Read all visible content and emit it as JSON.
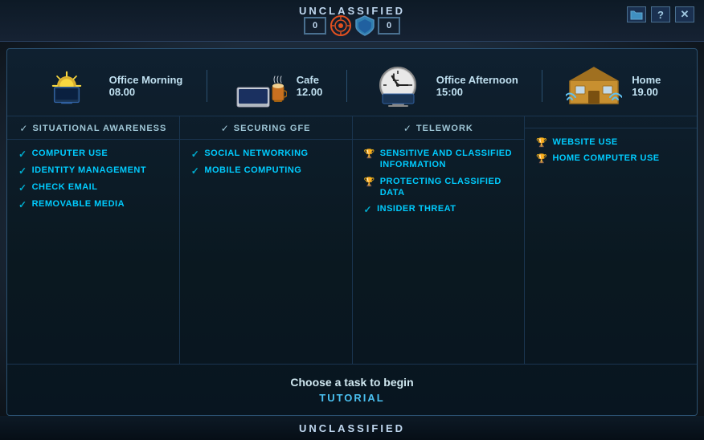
{
  "classification": {
    "top_label": "UNCLASSIFIED",
    "bottom_label": "UNCLASSIFIED"
  },
  "top_bar": {
    "score_left": "0",
    "score_right": "0",
    "buttons": [
      "folder-icon",
      "question-icon",
      "close-icon"
    ]
  },
  "timeline": {
    "items": [
      {
        "name": "Office Morning",
        "time": "08.00",
        "icon": "sun"
      },
      {
        "name": "Cafe",
        "time": "12.00",
        "icon": "laptop"
      },
      {
        "name": "Office Afternoon",
        "time": "15:00",
        "icon": "clock"
      },
      {
        "name": "Home",
        "time": "19.00",
        "icon": "house"
      }
    ]
  },
  "categories": [
    {
      "header": "SITUATIONAL AWARENESS",
      "items": [
        {
          "label": "COMPUTER USE",
          "icon": "check"
        },
        {
          "label": "IDENTITY MANAGEMENT",
          "icon": "check"
        },
        {
          "label": "CHECK EMAIL",
          "icon": "check"
        },
        {
          "label": "REMOVABLE MEDIA",
          "icon": "check"
        }
      ]
    },
    {
      "header": "SECURING GFE",
      "items": [
        {
          "label": "SOCIAL NETWORKING",
          "icon": "check"
        },
        {
          "label": "MOBILE COMPUTING",
          "icon": "check"
        }
      ]
    },
    {
      "header": "TELEWORK",
      "items": [
        {
          "label": "SENSITIVE AND CLASSIFIED INFORMATION",
          "icon": "trophy"
        },
        {
          "label": "PROTECTING CLASSIFIED DATA",
          "icon": "trophy"
        },
        {
          "label": "INSIDER THREAT",
          "icon": "check"
        }
      ]
    },
    {
      "header": "",
      "items": [
        {
          "label": "WEBSITE USE",
          "icon": "trophy"
        },
        {
          "label": "HOME COMPUTER USE",
          "icon": "trophy"
        }
      ]
    }
  ],
  "cta": {
    "text": "Choose a task to begin",
    "tutorial_label": "TUTORIAL"
  }
}
